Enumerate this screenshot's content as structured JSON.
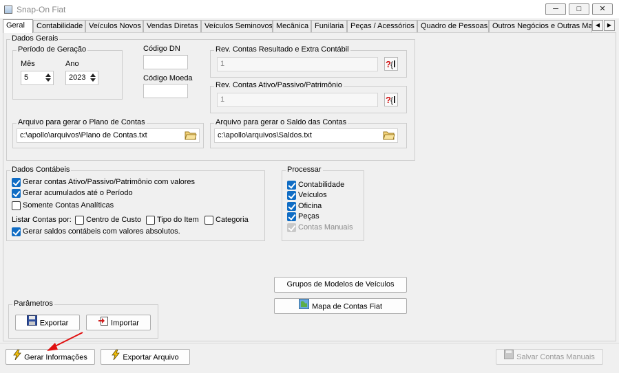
{
  "window": {
    "title": "Snap-On Fiat",
    "minimize_glyph": "─",
    "maximize_glyph": "□",
    "close_glyph": "✕"
  },
  "tabs": [
    {
      "label": "Geral",
      "active": true
    },
    {
      "label": "Contabilidade"
    },
    {
      "label": "Veículos Novos"
    },
    {
      "label": "Vendas Diretas"
    },
    {
      "label": "Veículos Seminovos"
    },
    {
      "label": "Mecânica"
    },
    {
      "label": "Funilaria"
    },
    {
      "label": "Peças / Acessórios"
    },
    {
      "label": "Quadro de Pessoas"
    },
    {
      "label": "Outros Negócios e Outras Man"
    }
  ],
  "tab_scroll": {
    "left": "◀",
    "right": "▶"
  },
  "dados_gerais": {
    "title": "Dados Gerais",
    "periodo": {
      "title": "Período de Geração",
      "mes_label": "Mês",
      "mes_value": "5",
      "ano_label": "Ano",
      "ano_value": "2023"
    },
    "codigo_dn_label": "Código DN",
    "codigo_dn_value": "",
    "codigo_moeda_label": "Código Moeda",
    "codigo_moeda_value": "",
    "rev_resultado": {
      "title": "Rev. Contas Resultado e Extra Contábil",
      "value": "1"
    },
    "rev_ativo": {
      "title": "Rev. Contas Ativo/Passivo/Patrimônio",
      "value": "1"
    },
    "plano_contas": {
      "title": "Arquivo para gerar o Plano de Contas",
      "value": "c:\\apollo\\arquivos\\Plano de Contas.txt"
    },
    "saldo_contas": {
      "title": "Arquivo para gerar o Saldo das Contas",
      "value": "c:\\apollo\\arquivos\\Saldos.txt"
    }
  },
  "dados_contabeis": {
    "title": "Dados Contábeis",
    "chk_ativo_passivo": "Gerar contas Ativo/Passivo/Patrimônio com valores",
    "chk_acumulados": "Gerar acumulados até o Período",
    "chk_analiticas": "Somente Contas Analíticas",
    "listar_label": "Listar Contas por:",
    "chk_centro_custo": "Centro de Custo",
    "chk_tipo_item": "Tipo do Item",
    "chk_categoria": "Categoria",
    "chk_absolutos": "Gerar saldos contábeis com valores absolutos."
  },
  "processar": {
    "title": "Processar",
    "items": [
      {
        "label": "Contabilidade",
        "state": "checked"
      },
      {
        "label": "Veículos",
        "state": "checked"
      },
      {
        "label": "Oficina",
        "state": "checked"
      },
      {
        "label": "Peças",
        "state": "checked"
      },
      {
        "label": "Contas Manuais",
        "state": "disabled"
      }
    ]
  },
  "buttons": {
    "grupos_modelos": "Grupos de Modelos de Veículos",
    "mapa_contas": "Mapa de Contas Fiat",
    "exportar": "Exportar",
    "importar": "Importar",
    "gerar_informacoes": "Gerar Informações",
    "exportar_arquivo": "Exportar Arquivo",
    "salvar_contas_manuais": "Salvar Contas Manuais"
  },
  "parametros_title": "Parâmetros",
  "colors": {
    "checkbox_blue": "#0f6cc4",
    "annotation_arrow": "#e01010"
  }
}
